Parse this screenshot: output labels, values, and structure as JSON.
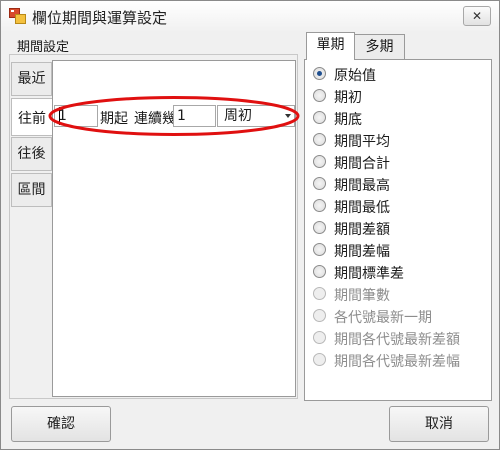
{
  "window": {
    "title": "欄位期間與運算設定",
    "close_glyph": "✕"
  },
  "period_group": {
    "label": "期間設定",
    "side_tabs": [
      "最近",
      "往前",
      "往後",
      "區間"
    ],
    "active_tab": "往前",
    "start_value": "1",
    "start_suffix": "期起",
    "count_label": "連續幾",
    "count_value": "1",
    "period_select": "周初",
    "highlight_color": "#e01010"
  },
  "calc_tabs": {
    "single": "單期",
    "multi": "多期"
  },
  "options": [
    {
      "label": "原始值",
      "selected": true,
      "enabled": true
    },
    {
      "label": "期初",
      "selected": false,
      "enabled": true
    },
    {
      "label": "期底",
      "selected": false,
      "enabled": true
    },
    {
      "label": "期間平均",
      "selected": false,
      "enabled": true
    },
    {
      "label": "期間合計",
      "selected": false,
      "enabled": true
    },
    {
      "label": "期間最高",
      "selected": false,
      "enabled": true
    },
    {
      "label": "期間最低",
      "selected": false,
      "enabled": true
    },
    {
      "label": "期間差額",
      "selected": false,
      "enabled": true
    },
    {
      "label": "期間差幅",
      "selected": false,
      "enabled": true
    },
    {
      "label": "期間標準差",
      "selected": false,
      "enabled": true
    },
    {
      "label": "期間筆數",
      "selected": false,
      "enabled": false
    },
    {
      "label": "各代號最新一期",
      "selected": false,
      "enabled": false
    },
    {
      "label": "期間各代號最新差額",
      "selected": false,
      "enabled": false
    },
    {
      "label": "期間各代號最新差幅",
      "selected": false,
      "enabled": false
    }
  ],
  "buttons": {
    "confirm": "確認",
    "cancel": "取消"
  }
}
